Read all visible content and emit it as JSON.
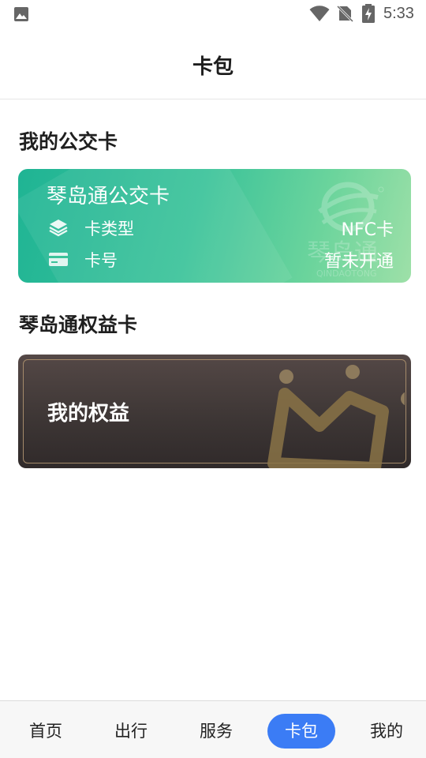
{
  "status_bar": {
    "time": "5:33",
    "icons": [
      "image-icon",
      "wifi-icon",
      "no-sim-icon",
      "battery-charging-icon"
    ]
  },
  "header": {
    "title": "卡包"
  },
  "bus_section": {
    "title": "我的公交卡",
    "card": {
      "name": "琴岛通公交卡",
      "type_label": "卡类型",
      "type_value": "NFC卡",
      "number_label": "卡号",
      "number_value": "暂未开通",
      "watermark_text": "琴岛通",
      "watermark_sub": "QINDAOTONG",
      "colors": {
        "start": "#1fb494",
        "end": "#9ee0a8"
      }
    }
  },
  "rights_section": {
    "title": "琴岛通权益卡",
    "card": {
      "title": "我的权益",
      "colors": {
        "background": "#3c3534",
        "frame": "#a48a6a"
      }
    }
  },
  "tab_bar": {
    "tabs": [
      {
        "label": "首页",
        "active": false
      },
      {
        "label": "出行",
        "active": false
      },
      {
        "label": "服务",
        "active": false
      },
      {
        "label": "卡包",
        "active": true
      },
      {
        "label": "我的",
        "active": false
      }
    ],
    "accent": "#3b7cf5"
  }
}
